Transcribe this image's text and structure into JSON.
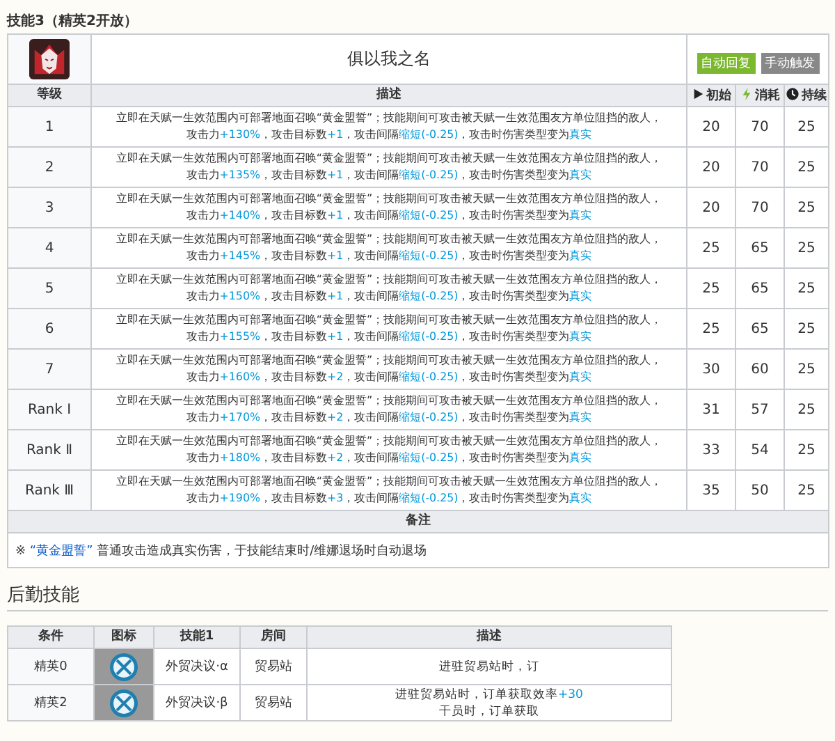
{
  "skill_heading": "技能3（精英2开放）",
  "skill": {
    "name": "俱以我之名",
    "tags": [
      {
        "label": "自动回复",
        "color": "#7cb82f"
      },
      {
        "label": "手动触发",
        "color": "#888888"
      }
    ]
  },
  "columns": [
    {
      "label": "等级"
    },
    {
      "label": "描述"
    },
    {
      "label": "初始"
    },
    {
      "label": "消耗"
    },
    {
      "label": "持续"
    }
  ],
  "rows": [
    {
      "level": "1",
      "line1": "立即在天赋一生效范围内可部署地面召唤“黄金盟誓”；技能期间可攻击被天赋一生效范围友方单位阻挡的敌人，",
      "line2": [
        {
          "text": "攻击力",
          "highlight": false
        },
        {
          "text": "+130%",
          "highlight": true
        },
        {
          "text": "，攻击目标数",
          "highlight": false
        },
        {
          "text": "+1",
          "highlight": true
        },
        {
          "text": "，攻击间隔",
          "highlight": false
        },
        {
          "text": "缩短(-0.25)",
          "highlight": true
        },
        {
          "text": "，攻击时伤害类型变为",
          "highlight": false
        },
        {
          "text": "真实",
          "highlight": true
        }
      ],
      "initial": "20",
      "cost": "70",
      "duration": "25"
    },
    {
      "level": "2",
      "line1": "立即在天赋一生效范围内可部署地面召唤“黄金盟誓”；技能期间可攻击被天赋一生效范围友方单位阻挡的敌人，",
      "line2": [
        {
          "text": "攻击力",
          "highlight": false
        },
        {
          "text": "+135%",
          "highlight": true
        },
        {
          "text": "，攻击目标数",
          "highlight": false
        },
        {
          "text": "+1",
          "highlight": true
        },
        {
          "text": "，攻击间隔",
          "highlight": false
        },
        {
          "text": "缩短(-0.25)",
          "highlight": true
        },
        {
          "text": "，攻击时伤害类型变为",
          "highlight": false
        },
        {
          "text": "真实",
          "highlight": true
        }
      ],
      "initial": "20",
      "cost": "70",
      "duration": "25"
    },
    {
      "level": "3",
      "line1": "立即在天赋一生效范围内可部署地面召唤“黄金盟誓”；技能期间可攻击被天赋一生效范围友方单位阻挡的敌人，",
      "line2": [
        {
          "text": "攻击力",
          "highlight": false
        },
        {
          "text": "+140%",
          "highlight": true
        },
        {
          "text": "，攻击目标数",
          "highlight": false
        },
        {
          "text": "+1",
          "highlight": true
        },
        {
          "text": "，攻击间隔",
          "highlight": false
        },
        {
          "text": "缩短(-0.25)",
          "highlight": true
        },
        {
          "text": "，攻击时伤害类型变为",
          "highlight": false
        },
        {
          "text": "真实",
          "highlight": true
        }
      ],
      "initial": "20",
      "cost": "70",
      "duration": "25"
    },
    {
      "level": "4",
      "line1": "立即在天赋一生效范围内可部署地面召唤“黄金盟誓”；技能期间可攻击被天赋一生效范围友方单位阻挡的敌人，",
      "line2": [
        {
          "text": "攻击力",
          "highlight": false
        },
        {
          "text": "+145%",
          "highlight": true
        },
        {
          "text": "，攻击目标数",
          "highlight": false
        },
        {
          "text": "+1",
          "highlight": true
        },
        {
          "text": "，攻击间隔",
          "highlight": false
        },
        {
          "text": "缩短(-0.25)",
          "highlight": true
        },
        {
          "text": "，攻击时伤害类型变为",
          "highlight": false
        },
        {
          "text": "真实",
          "highlight": true
        }
      ],
      "initial": "25",
      "cost": "65",
      "duration": "25"
    },
    {
      "level": "5",
      "line1": "立即在天赋一生效范围内可部署地面召唤“黄金盟誓”；技能期间可攻击被天赋一生效范围友方单位阻挡的敌人，",
      "line2": [
        {
          "text": "攻击力",
          "highlight": false
        },
        {
          "text": "+150%",
          "highlight": true
        },
        {
          "text": "，攻击目标数",
          "highlight": false
        },
        {
          "text": "+1",
          "highlight": true
        },
        {
          "text": "，攻击间隔",
          "highlight": false
        },
        {
          "text": "缩短(-0.25)",
          "highlight": true
        },
        {
          "text": "，攻击时伤害类型变为",
          "highlight": false
        },
        {
          "text": "真实",
          "highlight": true
        }
      ],
      "initial": "25",
      "cost": "65",
      "duration": "25"
    },
    {
      "level": "6",
      "line1": "立即在天赋一生效范围内可部署地面召唤“黄金盟誓”；技能期间可攻击被天赋一生效范围友方单位阻挡的敌人，",
      "line2": [
        {
          "text": "攻击力",
          "highlight": false
        },
        {
          "text": "+155%",
          "highlight": true
        },
        {
          "text": "，攻击目标数",
          "highlight": false
        },
        {
          "text": "+1",
          "highlight": true
        },
        {
          "text": "，攻击间隔",
          "highlight": false
        },
        {
          "text": "缩短(-0.25)",
          "highlight": true
        },
        {
          "text": "，攻击时伤害类型变为",
          "highlight": false
        },
        {
          "text": "真实",
          "highlight": true
        }
      ],
      "initial": "25",
      "cost": "65",
      "duration": "25"
    },
    {
      "level": "7",
      "line1": "立即在天赋一生效范围内可部署地面召唤“黄金盟誓”；技能期间可攻击被天赋一生效范围友方单位阻挡的敌人，",
      "line2": [
        {
          "text": "攻击力",
          "highlight": false
        },
        {
          "text": "+160%",
          "highlight": true
        },
        {
          "text": "，攻击目标数",
          "highlight": false
        },
        {
          "text": "+2",
          "highlight": true
        },
        {
          "text": "，攻击间隔",
          "highlight": false
        },
        {
          "text": "缩短(-0.25)",
          "highlight": true
        },
        {
          "text": "，攻击时伤害类型变为",
          "highlight": false
        },
        {
          "text": "真实",
          "highlight": true
        }
      ],
      "initial": "30",
      "cost": "60",
      "duration": "25"
    },
    {
      "level": "Rank Ⅰ",
      "line1": "立即在天赋一生效范围内可部署地面召唤“黄金盟誓”；技能期间可攻击被天赋一生效范围友方单位阻挡的敌人，",
      "line2": [
        {
          "text": "攻击力",
          "highlight": false
        },
        {
          "text": "+170%",
          "highlight": true
        },
        {
          "text": "，攻击目标数",
          "highlight": false
        },
        {
          "text": "+2",
          "highlight": true
        },
        {
          "text": "，攻击间隔",
          "highlight": false
        },
        {
          "text": "缩短(-0.25)",
          "highlight": true
        },
        {
          "text": "，攻击时伤害类型变为",
          "highlight": false
        },
        {
          "text": "真实",
          "highlight": true
        }
      ],
      "initial": "31",
      "cost": "57",
      "duration": "25"
    },
    {
      "level": "Rank Ⅱ",
      "line1": "立即在天赋一生效范围内可部署地面召唤“黄金盟誓”；技能期间可攻击被天赋一生效范围友方单位阻挡的敌人，",
      "line2": [
        {
          "text": "攻击力",
          "highlight": false
        },
        {
          "text": "+180%",
          "highlight": true
        },
        {
          "text": "，攻击目标数",
          "highlight": false
        },
        {
          "text": "+2",
          "highlight": true
        },
        {
          "text": "，攻击间隔",
          "highlight": false
        },
        {
          "text": "缩短(-0.25)",
          "highlight": true
        },
        {
          "text": "，攻击时伤害类型变为",
          "highlight": false
        },
        {
          "text": "真实",
          "highlight": true
        }
      ],
      "initial": "33",
      "cost": "54",
      "duration": "25"
    },
    {
      "level": "Rank Ⅲ",
      "line1": "立即在天赋一生效范围内可部署地面召唤“黄金盟誓”；技能期间可攻击被天赋一生效范围友方单位阻挡的敌人，",
      "line2": [
        {
          "text": "攻击力",
          "highlight": false
        },
        {
          "text": "+190%",
          "highlight": true
        },
        {
          "text": "，攻击目标数",
          "highlight": false
        },
        {
          "text": "+3",
          "highlight": true
        },
        {
          "text": "，攻击间隔",
          "highlight": false
        },
        {
          "text": "缩短(-0.25)",
          "highlight": true
        },
        {
          "text": "，攻击时伤害类型变为",
          "highlight": false
        },
        {
          "text": "真实",
          "highlight": true
        }
      ],
      "initial": "35",
      "cost": "50",
      "duration": "25"
    }
  ],
  "notes": {
    "heading": "备注",
    "mark": "※",
    "link": "“黄金盟誓”",
    "text": "普通攻击造成真实伤害，于技能结束时/维娜退场时自动退场"
  },
  "base_heading": "后勤技能",
  "base_columns": [
    "条件",
    "图标",
    "技能1",
    "房间",
    "描述"
  ],
  "base_rows": [
    {
      "condition": "精英0",
      "skill": "外贸决议·α",
      "room": "贸易站",
      "description": [
        [
          {
            "text": "进驻贸易站时，订",
            "highlight": false
          }
        ]
      ]
    },
    {
      "condition": "精英2",
      "skill": "外贸决议·β",
      "room": "贸易站",
      "description": [
        [
          {
            "text": "进驻贸易站时，订单获取效率",
            "highlight": false
          },
          {
            "text": "+30",
            "highlight": true
          }
        ],
        [
          {
            "text": "干员时，订单获取",
            "highlight": false
          }
        ]
      ]
    }
  ]
}
